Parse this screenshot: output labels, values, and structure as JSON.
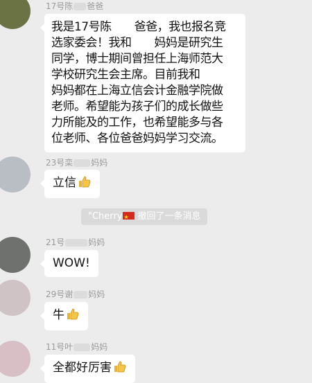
{
  "colors": {
    "background": "#ececec",
    "bubble": "#ffffff",
    "recall_pill": "#dadada",
    "sender_text": "#9a9a9a"
  },
  "messages": [
    {
      "sender_prefix": "17号陈",
      "sender_suffix": "爸爸",
      "lines": [
        "我是17号陈　　爸爸，我也报名竞",
        "选家委会！我和　　妈妈是研究生",
        "同学，博士期间曾担任上海师范大",
        "学校研究生会主席。目前我和　　",
        "妈妈都在上海立信会计金融学院做",
        "老师。希望能为孩子们的成长做些",
        "力所能及的工作，也希望能多与各",
        "位老师、各位爸爸妈妈学习交流。"
      ]
    },
    {
      "sender_prefix": "23号栾",
      "sender_suffix": "妈妈",
      "text": "立信",
      "icon": "thumbs-up-icon"
    },
    {
      "sender_prefix": "21号",
      "sender_suffix": "妈妈",
      "text": "WOW!"
    },
    {
      "sender_prefix": "29号谢",
      "sender_suffix": "妈妈",
      "text": "牛",
      "icon": "thumbs-up-icon"
    },
    {
      "sender_prefix": "11号叶",
      "sender_suffix": "妈妈",
      "text": "全都好厉害",
      "icon": "thumbs-up-icon"
    }
  ],
  "recall_notice": {
    "name": "\"Cherry",
    "flag_icon": "china-flag-icon",
    "text": "撤回了一条消息"
  }
}
